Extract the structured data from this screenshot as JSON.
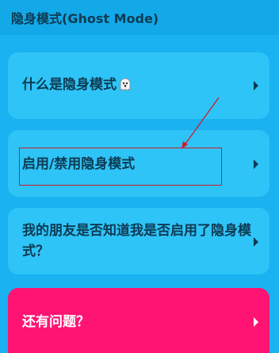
{
  "header": {
    "title": "隐身模式(Ghost Mode)"
  },
  "faq": {
    "items": [
      {
        "label": "什么是隐身模式",
        "icon": "ghost-emoji"
      },
      {
        "label": "启用/禁用隐身模式"
      },
      {
        "label": "我的朋友是否知道我是否启用了隐身模式？"
      }
    ],
    "more_label": "还有问题？"
  },
  "annotation": {
    "highlight_color": "#d11a2a"
  },
  "colors": {
    "background": "#1ab2f0",
    "card": "#2ec4f7",
    "text": "#0e3a52",
    "cta": "#ff1473"
  }
}
